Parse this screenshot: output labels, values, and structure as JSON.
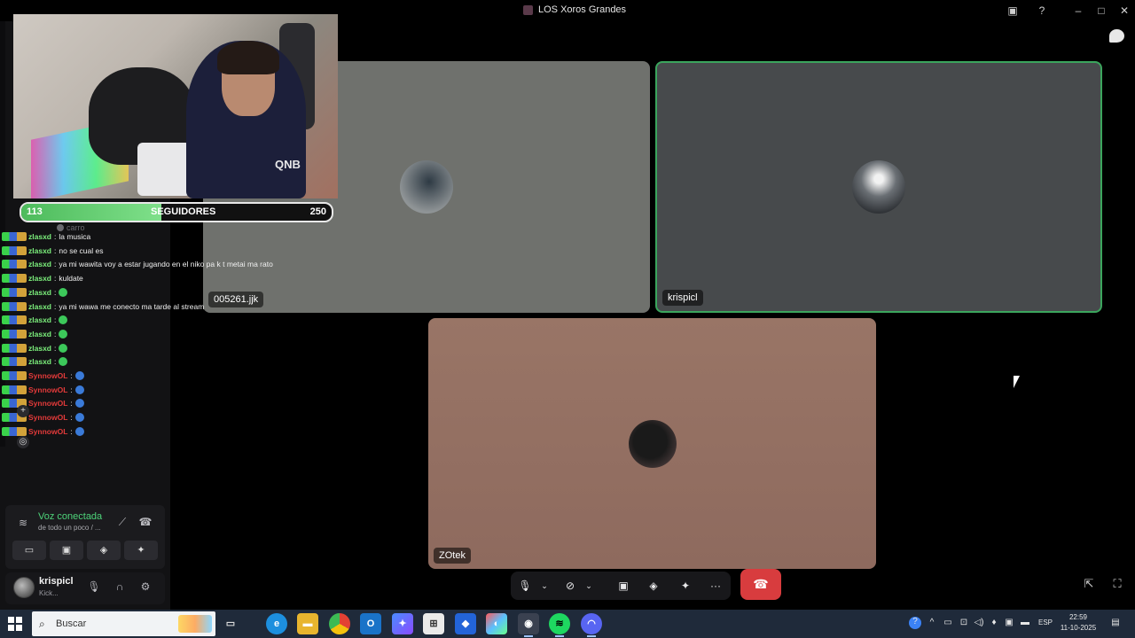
{
  "window": {
    "title": "LOS Xoros Grandes"
  },
  "stream_overlay": {
    "followers_current": "113",
    "followers_label": "SEGUIDORES",
    "followers_goal": "250",
    "followers_progress": 0.452,
    "jersey_text": "QNB"
  },
  "chat": {
    "faded_line": "carro",
    "lines": [
      {
        "user": "zlasxd",
        "msg": "la musica",
        "color": "#7cf07c",
        "emote": ""
      },
      {
        "user": "zlasxd",
        "msg": "no se cual es",
        "color": "#7cf07c",
        "emote": ""
      },
      {
        "user": "zlasxd",
        "msg": "ya mi wawita voy a estar jugando en el niko pa k t metai ma rato",
        "color": "#7cf07c",
        "emote": ""
      },
      {
        "user": "zlasxd",
        "msg": "kuldate",
        "color": "#7cf07c",
        "emote": ""
      },
      {
        "user": "zlasxd",
        "msg": "",
        "color": "#7cf07c",
        "emote": "#3cc85a"
      },
      {
        "user": "zlasxd",
        "msg": "ya mi wawa me conecto ma tarde al stream",
        "color": "#7cf07c",
        "emote": ""
      },
      {
        "user": "zlasxd",
        "msg": "",
        "color": "#7cf07c",
        "emote": "#3cc85a"
      },
      {
        "user": "zlasxd",
        "msg": "",
        "color": "#7cf07c",
        "emote": "#3cc85a"
      },
      {
        "user": "zlasxd",
        "msg": "",
        "color": "#7cf07c",
        "emote": "#3cc85a"
      },
      {
        "user": "zlasxd",
        "msg": "",
        "color": "#7cf07c",
        "emote": "#3cc85a"
      },
      {
        "user": "SynnowOL",
        "msg": "",
        "color": "#e33a3a",
        "emote": "#3a7ad8"
      },
      {
        "user": "SynnowOL",
        "msg": "",
        "color": "#e33a3a",
        "emote": "#3a7ad8"
      },
      {
        "user": "SynnowOL",
        "msg": "",
        "color": "#e33a3a",
        "emote": "#3a7ad8"
      },
      {
        "user": "SynnowOL",
        "msg": "",
        "color": "#e33a3a",
        "emote": "#3a7ad8"
      },
      {
        "user": "SynnowOL",
        "msg": "",
        "color": "#e33a3a",
        "emote": "#3a7ad8"
      }
    ]
  },
  "voice": {
    "status": "Voz conectada",
    "channel": "de todo un poco / ..."
  },
  "user": {
    "name": "krispicl",
    "status": "Kick..."
  },
  "participants": [
    {
      "name": "005261.jjk"
    },
    {
      "name": "krispicl"
    },
    {
      "name": "ZOtek"
    }
  ],
  "taskbar": {
    "search_placeholder": "Buscar",
    "language": "ESP",
    "time": "22:59",
    "date": "11-10-2025"
  }
}
